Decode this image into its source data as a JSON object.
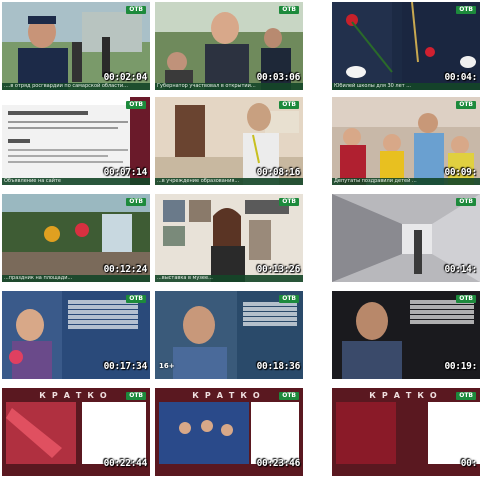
{
  "channel_logo": "OTB",
  "tiles": [
    {
      "timecode": "00:02:04",
      "caption": "....в отряд росгвардии по самарской области..."
    },
    {
      "timecode": "00:03:06",
      "caption": "Губернатор участвовал в открытии..."
    },
    {
      "timecode": "00:04:",
      "caption": "Юбилей школы для 30 лет ..."
    },
    {
      "timecode": "00:07:14",
      "caption": "Объявление на сайте"
    },
    {
      "timecode": "00:08:16",
      "caption": "...в учреждение образования..."
    },
    {
      "timecode": "00:09:",
      "caption": "Депутаты поздравили детей ..."
    },
    {
      "timecode": "00:12:24",
      "caption": "...праздник на площади..."
    },
    {
      "timecode": "00:13:26",
      "caption": "...выставка в музее..."
    },
    {
      "timecode": "00:14:",
      "caption": ""
    },
    {
      "timecode": "00:17:34",
      "caption": ""
    },
    {
      "timecode": "00:18:36",
      "caption": "16+"
    },
    {
      "timecode": "00:19:",
      "caption": ""
    },
    {
      "timecode": "00:22:44",
      "caption": "КРАТКО"
    },
    {
      "timecode": "00:23:46",
      "caption": "КРАТКО"
    },
    {
      "timecode": "00:",
      "caption": "КРАТКО"
    }
  ],
  "colors": {
    "accent": "#1d8a3c",
    "caption_bg": "#144628"
  }
}
